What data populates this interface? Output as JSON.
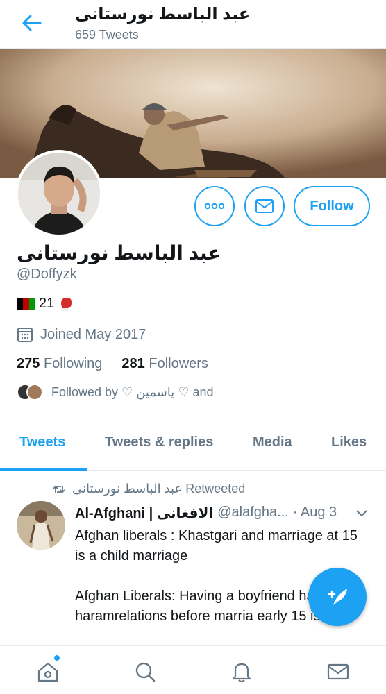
{
  "header": {
    "title": "عبد الباسط نورستانی",
    "tweet_count": "659 Tweets",
    "back_icon": "arrow-left-icon"
  },
  "profile": {
    "name": "عبد الباسط نورستانی",
    "handle": "@Doffyzk",
    "bio_age": "21",
    "joined": "Joined May 2017",
    "following_count": "275",
    "following_label": "Following",
    "followers_count": "281",
    "followers_label": "Followers",
    "followed_by": "Followed by ♡ یاسمین ♡ and"
  },
  "actions": {
    "more_icon": "more-icon",
    "mail_icon": "mail-icon",
    "follow_label": "Follow"
  },
  "tabs": [
    {
      "label": "Tweets"
    },
    {
      "label": "Tweets & replies"
    },
    {
      "label": "Media"
    },
    {
      "label": "Likes"
    }
  ],
  "tweet": {
    "retweeted_by": "عبد الباسط نورستانی Retweeted",
    "author_name": "Al-Afghani | الافغانی",
    "author_handle": "@alafgha...",
    "date": "· Aug 3",
    "paragraph1": "Afghan liberals : Khastgari and marriage at 15 is a child marriage",
    "paragraph2": "Afghan Liberals: Having a boyfriend having haramrelations before marria early 15 is OK."
  },
  "colors": {
    "accent": "#1da1f2",
    "secondary_text": "#657786"
  },
  "nav": [
    "home-icon",
    "search-icon",
    "notifications-icon",
    "messages-icon"
  ]
}
